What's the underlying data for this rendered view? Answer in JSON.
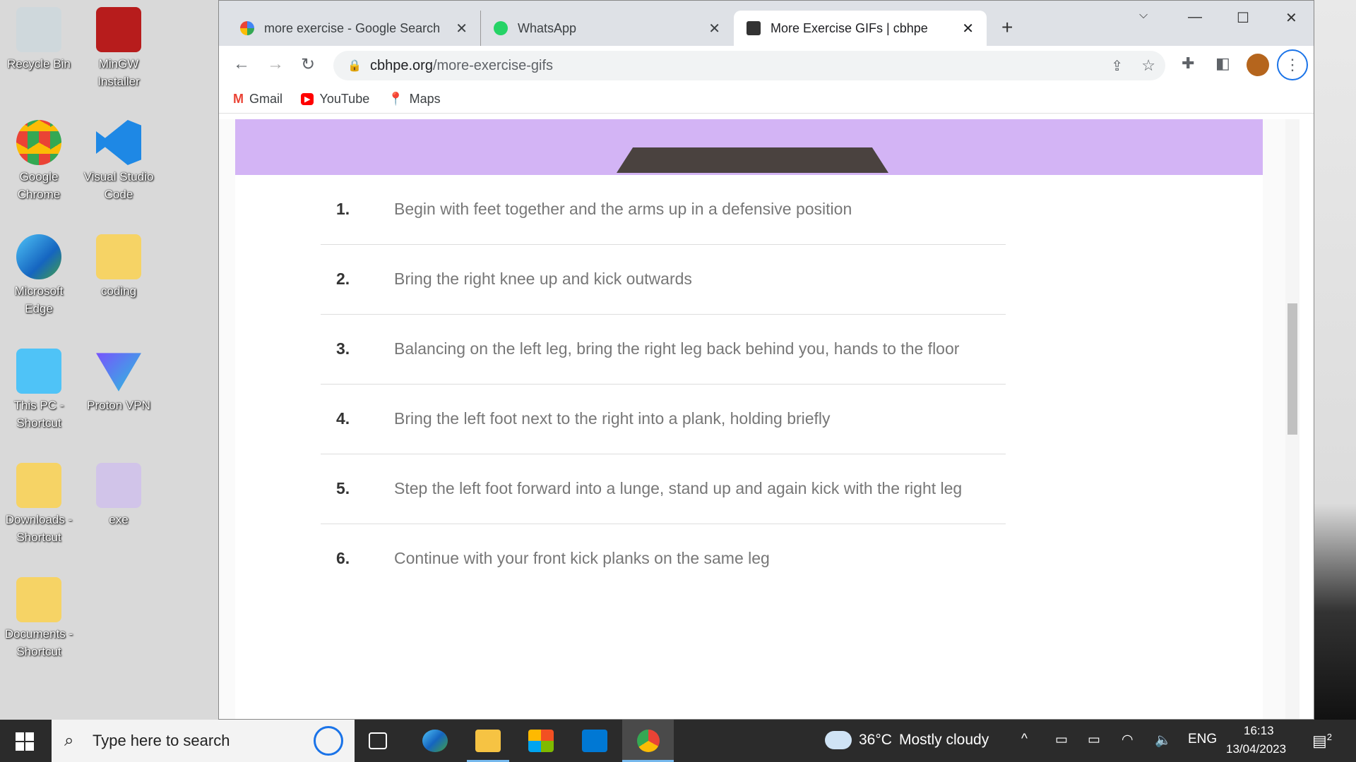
{
  "desktop": {
    "icons": [
      {
        "label": "Recycle Bin",
        "icon": "recycle-bin-icon"
      },
      {
        "label": "MinGW Installer",
        "icon": "installer-icon"
      },
      {
        "label": "Google Chrome",
        "icon": "chrome-icon"
      },
      {
        "label": "Visual Studio Code",
        "icon": "vscode-icon"
      },
      {
        "label": "Microsoft Edge",
        "icon": "edge-icon"
      },
      {
        "label": "coding",
        "icon": "folder-icon"
      },
      {
        "label": "This PC - Shortcut",
        "icon": "pc-icon"
      },
      {
        "label": "Proton VPN",
        "icon": "protonvpn-icon"
      },
      {
        "label": "Downloads - Shortcut",
        "icon": "downloads-folder-icon"
      },
      {
        "label": "exe",
        "icon": "folder-icon"
      },
      {
        "label": "Documents - Shortcut",
        "icon": "documents-folder-icon"
      }
    ]
  },
  "browser": {
    "tabs": [
      {
        "title": "more exercise - Google Search"
      },
      {
        "title": "WhatsApp"
      },
      {
        "title": "More Exercise GIFs | cbhpe"
      }
    ],
    "url_domain": "cbhpe.org",
    "url_path": "/more-exercise-gifs",
    "bookmarks": [
      {
        "label": "Gmail"
      },
      {
        "label": "YouTube"
      },
      {
        "label": "Maps"
      }
    ]
  },
  "page": {
    "steps": [
      {
        "n": "1.",
        "text": "Begin with feet together and the arms up in a defensive position"
      },
      {
        "n": "2.",
        "text": "Bring the right knee up and kick outwards"
      },
      {
        "n": "3.",
        "text": "Balancing on the left leg, bring the right leg back behind you, hands to the floor"
      },
      {
        "n": "4.",
        "text": "Bring the left foot next to the right into a plank, holding briefly"
      },
      {
        "n": "5.",
        "text": "Step the left foot forward into a lunge, stand up and again kick with the right leg"
      },
      {
        "n": "6.",
        "text": "Continue with your front kick planks on the same leg"
      }
    ]
  },
  "taskbar": {
    "search_placeholder": "Type here to search",
    "weather": "36°C",
    "weather_desc": "Mostly cloudy",
    "lang": "ENG",
    "time": "16:13",
    "date": "13/04/2023",
    "notifications": "2"
  }
}
